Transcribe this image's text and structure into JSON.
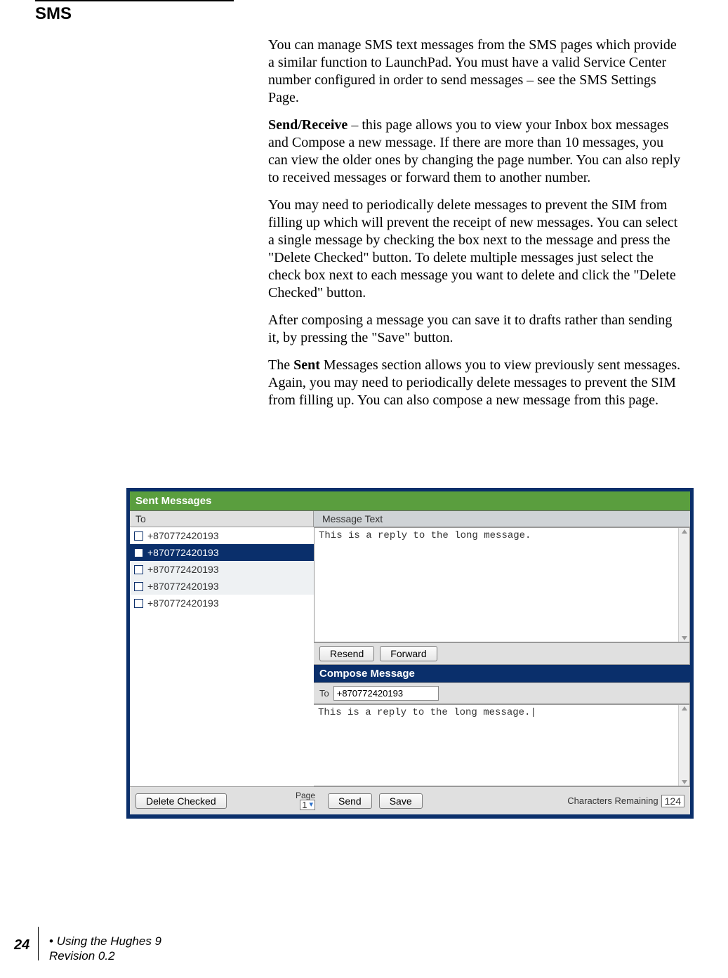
{
  "section_title": "SMS",
  "paragraphs": {
    "p1": "You can manage SMS text messages from the SMS pages which provide a similar function to LaunchPad. You must have a valid Service Center number configured in order to send messages – see the SMS Settings Page.",
    "p2_label": "Send/Receive",
    "p2_rest": " – this page allows you to view your Inbox box messages and Compose a new message. If there are more than 10 messages, you can view the older ones by changing the page number. You can also reply to received messages or forward them to another number.",
    "p3": "You may need to periodically delete messages to prevent the SIM from filling up which will prevent the receipt of new messages. You can select a single message by checking the box next to the message and press the \"Delete Checked\" button.  To delete multiple messages just select the check box next to each message you want to delete and click the \"Delete Checked\" button.",
    "p4": "After composing a message you can save it to drafts rather than sending it, by pressing the \"Save\" button.",
    "p5_pre": "The ",
    "p5_bold": "Sent",
    "p5_post": " Messages section allows you to view previously sent messages. Again, you may need to periodically delete messages to prevent the SIM from filling up.  You can also compose a new message from this page."
  },
  "screenshot": {
    "title": "Sent Messages",
    "col_to": "To",
    "col_msg": "Message Text",
    "rows": [
      {
        "num": "+870772420193"
      },
      {
        "num": "+870772420193"
      },
      {
        "num": "+870772420193"
      },
      {
        "num": "+870772420193"
      },
      {
        "num": "+870772420193"
      }
    ],
    "display_text": "This is a reply to the long message.",
    "resend": "Resend",
    "forward": "Forward",
    "compose_title": "Compose Message",
    "to_label": "To",
    "to_value": "+870772420193",
    "compose_text": "This is a reply to the long message.|",
    "delete_checked": "Delete Checked",
    "page_label": "Page",
    "page_value": "1",
    "send": "Send",
    "save": "Save",
    "chars_label": "Characters Remaining",
    "chars_value": "124"
  },
  "footer": {
    "page_number": "24",
    "line1": "Using the Hughes 9",
    "line2": "Revision 0.2"
  }
}
